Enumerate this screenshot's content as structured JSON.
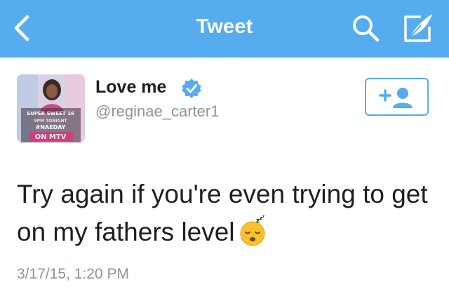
{
  "nav": {
    "title": "Tweet",
    "back_icon": "chevron-left-icon",
    "search_icon": "search-icon",
    "compose_icon": "compose-tweet-icon",
    "bar_color": "#55acee"
  },
  "author": {
    "name": "Love me",
    "handle": "@reginae_carter1",
    "verified": true,
    "avatar_text": {
      "line1": "SUPER SWEET 16",
      "line2": "9PM TONIGHT",
      "line3": "#NAEDAY",
      "line4": "ON MTV"
    }
  },
  "follow_button": {
    "icon": "add-user-icon"
  },
  "tweet": {
    "text": "Try again if you're even trying to get on my fathers level",
    "emoji": "sleeping-face-emoji",
    "timestamp": "3/17/15, 1:20 PM"
  }
}
